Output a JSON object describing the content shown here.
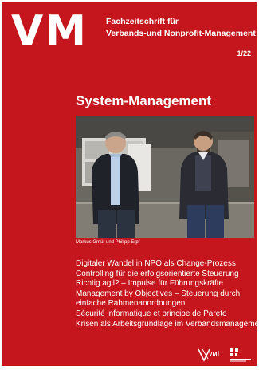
{
  "magazine": {
    "logo_text": "VM",
    "subtitle_line1": "Fachzeitschrift für",
    "subtitle_line2": "Verbands-und Nonprofit-Management",
    "issue": "1/22"
  },
  "section_title": "System-Management",
  "photo_credit": "Markus Gmür und Philipp Erpf",
  "toc": [
    "Digitaler Wandel in NPO als Change-Prozess",
    "Controlling für die erfolgsorientierte Steuerung",
    "Richtig agil? – Impulse für Führungskräfte",
    "Management by Objectives – Steuerung durch",
    "einfache Rahmenanordnungen",
    "Sécurité informatique et principe de Pareto",
    "Krisen als Arbeitsgrundlage im Verbandsmanagement"
  ],
  "colors": {
    "cover_background": "#c4161c",
    "text": "#ffffff"
  },
  "icons": {
    "photo": "two-men-portrait-photo",
    "footer_left": "vmi-logo-icon",
    "footer_right": "university-logo-icon"
  }
}
